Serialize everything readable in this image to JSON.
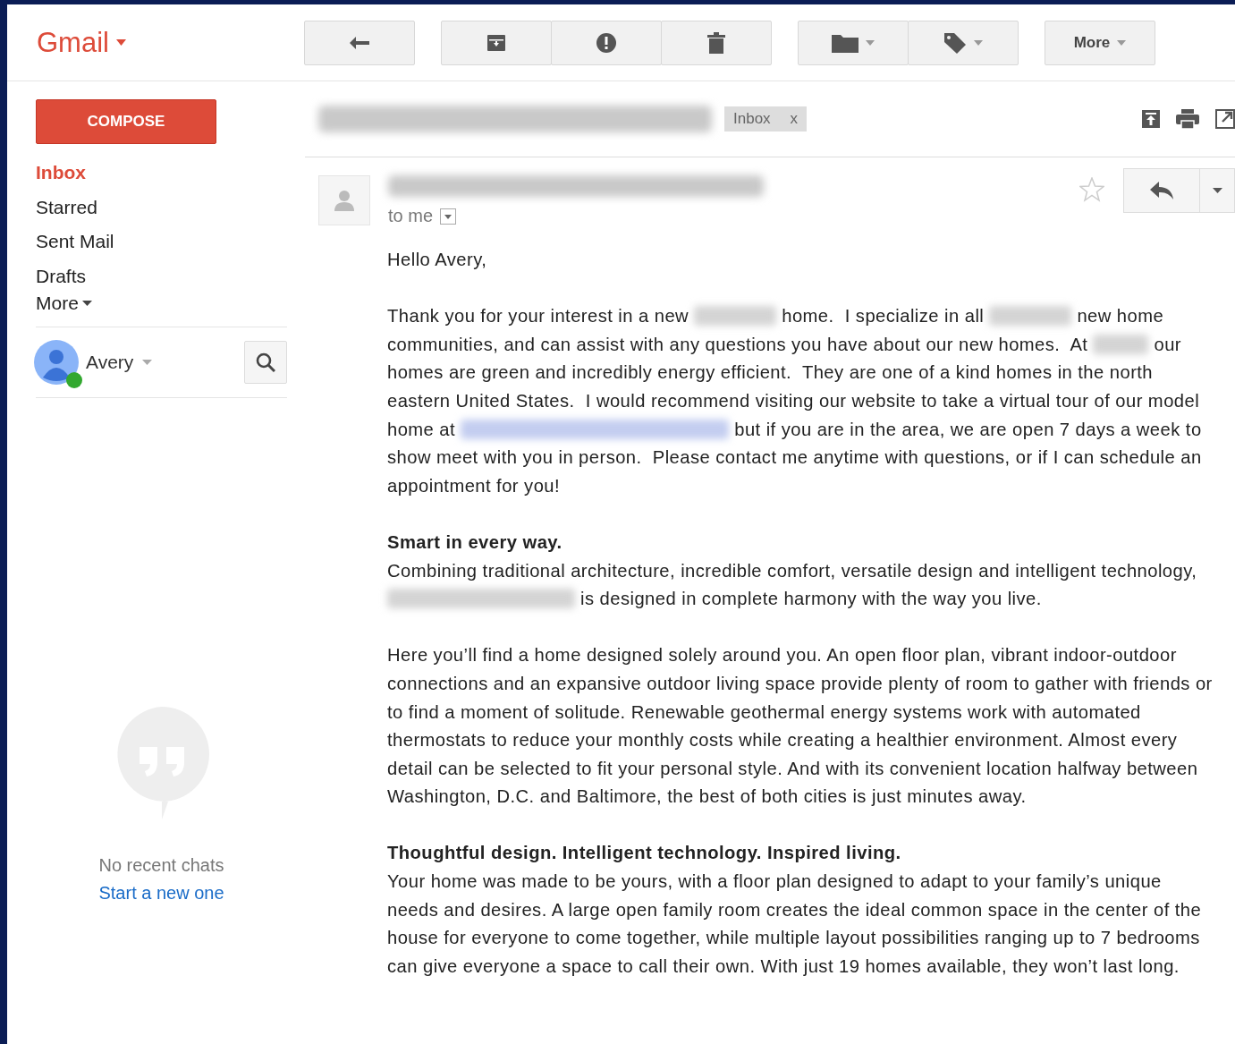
{
  "header": {
    "logo": "Gmail",
    "more_button": "More"
  },
  "sidebar": {
    "compose": "COMPOSE",
    "items": [
      {
        "label": "Inbox",
        "selected": true
      },
      {
        "label": "Starred",
        "selected": false
      },
      {
        "label": "Sent Mail",
        "selected": false
      },
      {
        "label": "Drafts",
        "selected": false
      }
    ],
    "more": "More",
    "user": {
      "name": "Avery",
      "online": true
    },
    "chats": {
      "empty": "No recent chats",
      "link": "Start a new one"
    }
  },
  "message": {
    "label_chip": {
      "label": "Inbox",
      "remove": "x"
    },
    "recipient": "to me",
    "starred": false,
    "blocks": [
      {
        "segments": [
          {
            "kind": "text",
            "text": "Hello Avery,"
          }
        ]
      },
      {
        "segments": [
          {
            "kind": "text",
            "text": "Thank you for your interest in a new "
          },
          {
            "kind": "redacted"
          },
          {
            "kind": "text",
            "text": " home.  I specialize in all "
          },
          {
            "kind": "redacted"
          },
          {
            "kind": "text",
            "text": " new home communities, and can assist with any questions you have about our new homes.  At "
          },
          {
            "kind": "redacted_short"
          },
          {
            "kind": "text",
            "text": " our homes are green and incredibly energy efficient.  They are one of a kind homes in the north eastern United States.  I would recommend visiting our website to take a virtual tour of our model home at "
          },
          {
            "kind": "redacted_link"
          },
          {
            "kind": "text",
            "text": " but if you are in the area, we are open 7 days a week to show meet with you in person.  Please contact me anytime with questions, or if I can schedule an appointment for you!"
          }
        ]
      },
      {
        "heading": "Smart in every way.",
        "segments": [
          {
            "kind": "text",
            "text": "Combining traditional architecture, incredible comfort, versatile design and intelligent technology, "
          },
          {
            "kind": "redacted_long"
          },
          {
            "kind": "text",
            "text": " is designed in complete harmony with the way you live."
          }
        ]
      },
      {
        "segments": [
          {
            "kind": "text",
            "text": "Here you’ll find a home designed solely around you. An open floor plan, vibrant indoor-outdoor connections and an expansive outdoor living space provide plenty of room to gather with friends or to find a moment of solitude. Renewable geothermal energy systems work with automated thermostats to reduce your monthly costs while creating a healthier environment. Almost every detail can be selected to fit your personal style. And with its convenient location halfway between Washington, D.C. and Baltimore, the best of both cities is just minutes away."
          }
        ]
      },
      {
        "heading": "Thoughtful design. Intelligent technology. Inspired living.",
        "segments": [
          {
            "kind": "text",
            "text": "Your home was made to be yours, with a floor plan designed to adapt to your family’s unique needs and desires. A large open family room creates the ideal common space in the center of the house for everyone to come together, while multiple layout possibilities ranging up to 7 bedrooms can give everyone a space to call their own. With just 19 homes available, they won’t last long."
          }
        ]
      }
    ]
  }
}
